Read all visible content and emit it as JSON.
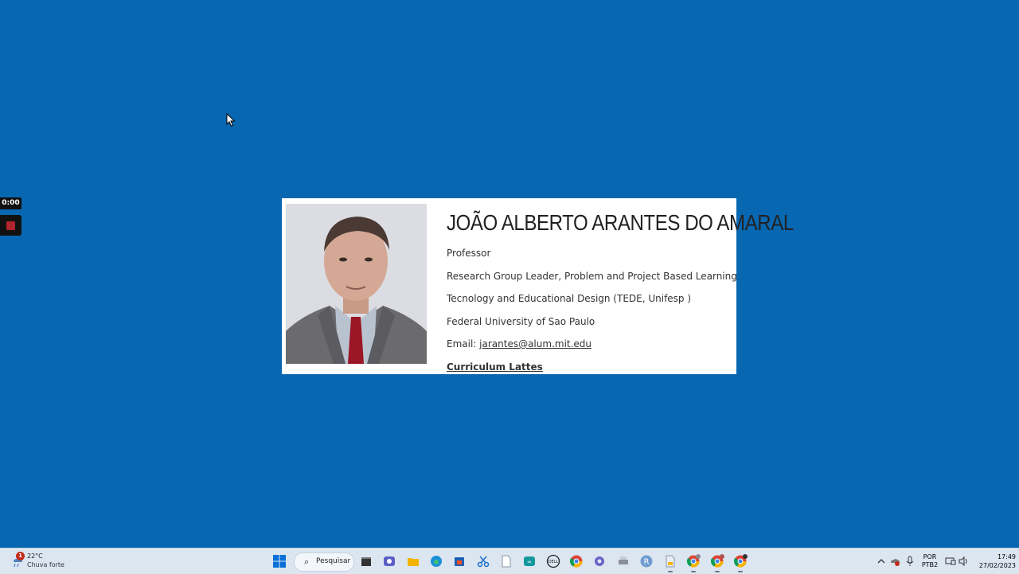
{
  "recorder": {
    "timer": "0:00"
  },
  "profile": {
    "name": "JOÃO ALBERTO ARANTES DO AMARAL",
    "role": "Professor",
    "group": "Research Group Leader, Problem and Project Based Learning",
    "dept": "Tecnology and Educational Design (TEDE, Unifesp )",
    "university": "Federal University of Sao Paulo",
    "email_label": "Email: ",
    "email": "jarantes@alum.mit.edu",
    "lattes": "Curriculum Lattes",
    "photo_alt": "photo"
  },
  "taskbar": {
    "weather": {
      "badge": "1",
      "temp": "22°C",
      "condition": "Chuva forte"
    },
    "search_label": "Pesquisar",
    "apps": [
      "start-icon",
      "terminal-icon",
      "teams-icon",
      "file-explorer-icon",
      "edge-icon",
      "store-icon",
      "snipping-tool-icon",
      "notepad-icon",
      "arduino-icon",
      "dell-icon",
      "chrome-icon",
      "settings-icon",
      "printer-icon",
      "r-icon",
      "file-manager-icon",
      "chrome-profile-icon",
      "chrome-profile-icon",
      "chrome-profile-icon"
    ],
    "language": {
      "line1": "POR",
      "line2": "PTB2"
    },
    "clock": {
      "time": "17:49",
      "date": "27/02/2023"
    }
  },
  "colors": {
    "desktop": "#0767b1",
    "taskbar": "#dce6f1",
    "card": "#ffffff"
  }
}
